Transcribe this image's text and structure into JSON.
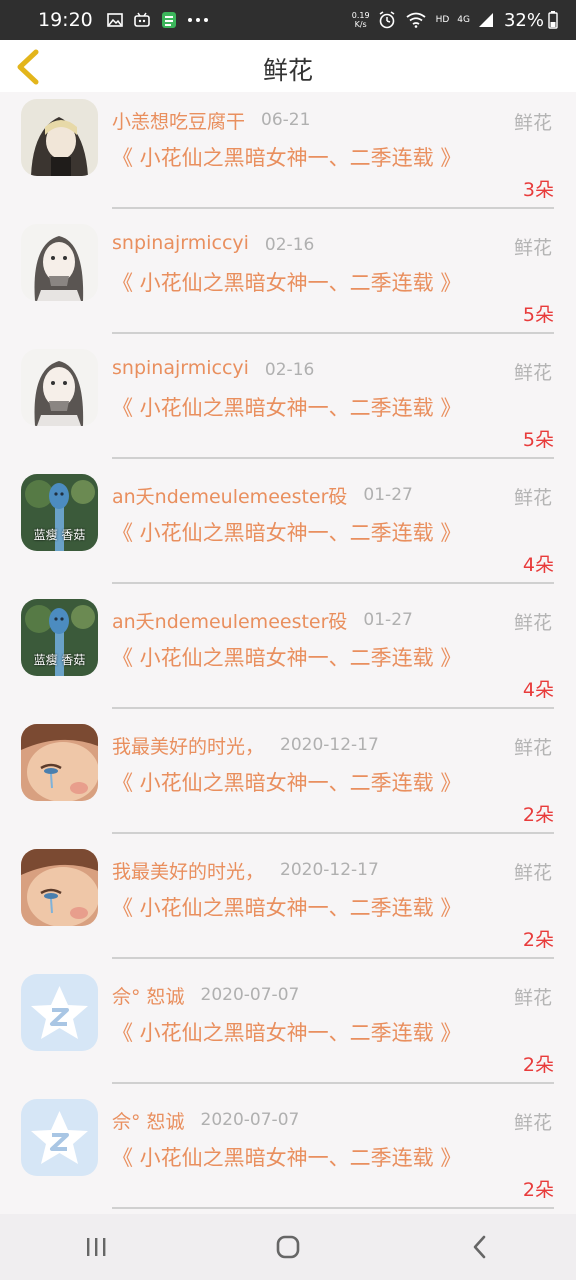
{
  "status_bar": {
    "time": "19:20",
    "speed_value": "0.19",
    "speed_unit": "K/s",
    "hd": "HD",
    "network": "4G",
    "battery": "32%"
  },
  "header": {
    "title": "鲜花"
  },
  "records": [
    {
      "nickname": "小恙想吃豆腐干",
      "date": "06-21",
      "gift": "鲜花",
      "book": "《 小花仙之黑暗女神一、二季连载 》",
      "count": "3朵",
      "avatar": "girl-hood"
    },
    {
      "nickname": "snpinajrmiccyi",
      "date": "02-16",
      "gift": "鲜花",
      "book": "《 小花仙之黑暗女神一、二季连载 》",
      "count": "5朵",
      "avatar": "girl-sketch"
    },
    {
      "nickname": "snpinajrmiccyi",
      "date": "02-16",
      "gift": "鲜花",
      "book": "《 小花仙之黑暗女神一、二季连载 》",
      "count": "5朵",
      "avatar": "girl-sketch"
    },
    {
      "nickname": "an夭ndemeulemeester砓",
      "date": "01-27",
      "gift": "鲜花",
      "book": "《 小花仙之黑暗女神一、二季连载 》",
      "count": "4朵",
      "avatar": "blue-mushroom",
      "avatar_caption": "蓝瘦 香菇"
    },
    {
      "nickname": "an夭ndemeulemeester砓",
      "date": "01-27",
      "gift": "鲜花",
      "book": "《 小花仙之黑暗女神一、二季连载 》",
      "count": "4朵",
      "avatar": "blue-mushroom",
      "avatar_caption": "蓝瘦 香菇"
    },
    {
      "nickname": "我最美好的时光，",
      "date": "2020-12-17",
      "gift": "鲜花",
      "book": "《 小花仙之黑暗女神一、二季连载 》",
      "count": "2朵",
      "avatar": "crying-face"
    },
    {
      "nickname": "我最美好的时光，",
      "date": "2020-12-17",
      "gift": "鲜花",
      "book": "《 小花仙之黑暗女神一、二季连载 》",
      "count": "2朵",
      "avatar": "crying-face"
    },
    {
      "nickname": "佘° 恕诚",
      "date": "2020-07-07",
      "gift": "鲜花",
      "book": "《 小花仙之黑暗女神一、二季连载 》",
      "count": "2朵",
      "avatar": "qq-default"
    },
    {
      "nickname": "佘° 恕诚",
      "date": "2020-07-07",
      "gift": "鲜花",
      "book": "《 小花仙之黑暗女神一、二季连载 》",
      "count": "2朵",
      "avatar": "qq-default"
    }
  ],
  "colors": {
    "accent_orange": "#e98f5e",
    "count_red": "#e83b3b",
    "muted_gray": "#b0b0b0",
    "back_arrow": "#e3b51b"
  }
}
